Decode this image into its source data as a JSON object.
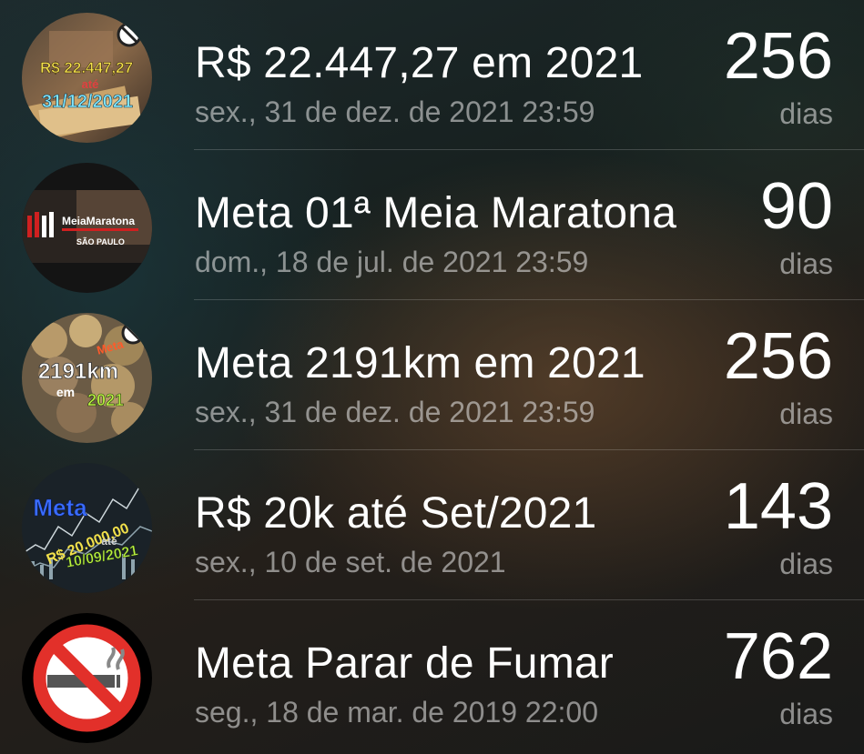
{
  "countdowns": [
    {
      "title": "R$ 22.447,27 em 2021",
      "date": "sex., 31 de dez. de 2021 23:59",
      "count": "256",
      "unit": "dias",
      "thumb": {
        "icon": "money-goal-thumbnail",
        "line1": "R$ 22.447,27",
        "line2": "até",
        "line3": "31/12/2021"
      }
    },
    {
      "title": "Meta 01ª Meia Maratona",
      "date": "dom., 18 de jul. de 2021 23:59",
      "count": "90",
      "unit": "dias",
      "thumb": {
        "icon": "half-marathon-thumbnail",
        "line1": "MeiaMaratona",
        "line2": "SÃO PAULO"
      }
    },
    {
      "title": "Meta 2191km em 2021",
      "date": "sex., 31 de dez. de 2021 23:59",
      "count": "256",
      "unit": "dias",
      "thumb": {
        "icon": "coins-goal-thumbnail",
        "line1": "Meta",
        "line2": "2191km",
        "line3": "em",
        "line4": "2021"
      }
    },
    {
      "title": "R$ 20k até Set/2021",
      "date": "sex., 10 de set. de 2021",
      "count": "143",
      "unit": "dias",
      "thumb": {
        "icon": "stock-chart-thumbnail",
        "line1": "Meta",
        "line2": "R$ 20.000,00",
        "line3": "até",
        "line4": "10/09/2021"
      }
    },
    {
      "title": "Meta Parar de Fumar",
      "date": "seg., 18 de mar. de 2019 22:00",
      "count": "762",
      "unit": "dias",
      "thumb": {
        "icon": "no-smoking-icon"
      }
    }
  ]
}
